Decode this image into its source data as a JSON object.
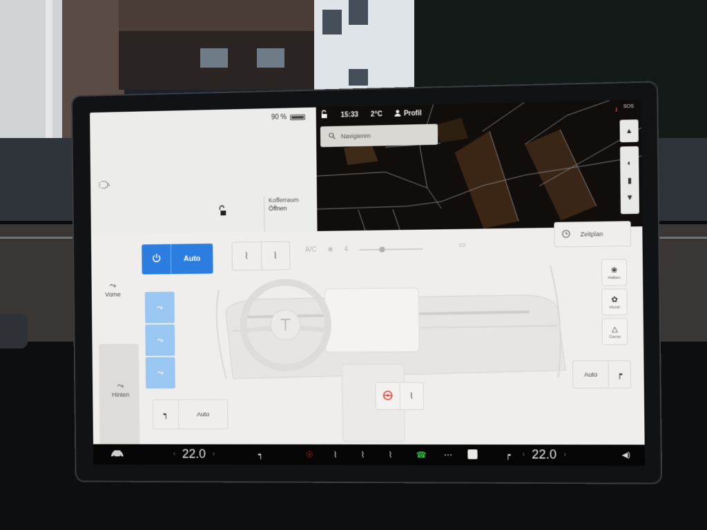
{
  "status_bar": {
    "battery_percent": "90 %",
    "battery_level": 0.9,
    "time": "15:33",
    "outside_temp": "2°C",
    "profile_label": "Profil",
    "sos_label": "SOS"
  },
  "car_panel": {
    "trunk_label": "Kofferraum",
    "trunk_action": "Öffnen"
  },
  "map": {
    "search_placeholder": "Navigieren"
  },
  "climate": {
    "auto_label": "Auto",
    "ac_label": "A/C",
    "fan_level_label": "4",
    "fan_level_fraction": 0.32,
    "schedule_label": "Zeitplan",
    "zone_front_label": "Vorne",
    "zone_rear_label": "Hinten",
    "seat_left_mode": "Auto",
    "seat_right_mode": "Auto",
    "modes": [
      {
        "label": "Halten",
        "icon": "fan-icon"
      },
      {
        "label": "Hund",
        "icon": "paw-icon"
      },
      {
        "label": "Camp",
        "icon": "tent-icon"
      }
    ]
  },
  "dock": {
    "driver_temp": "22.0",
    "passenger_temp": "22.0"
  },
  "colors": {
    "accent": "#2b7de0",
    "vent_active": "#9ac6f2",
    "heat_red": "#e53b2e",
    "phone_green": "#35c24a"
  }
}
